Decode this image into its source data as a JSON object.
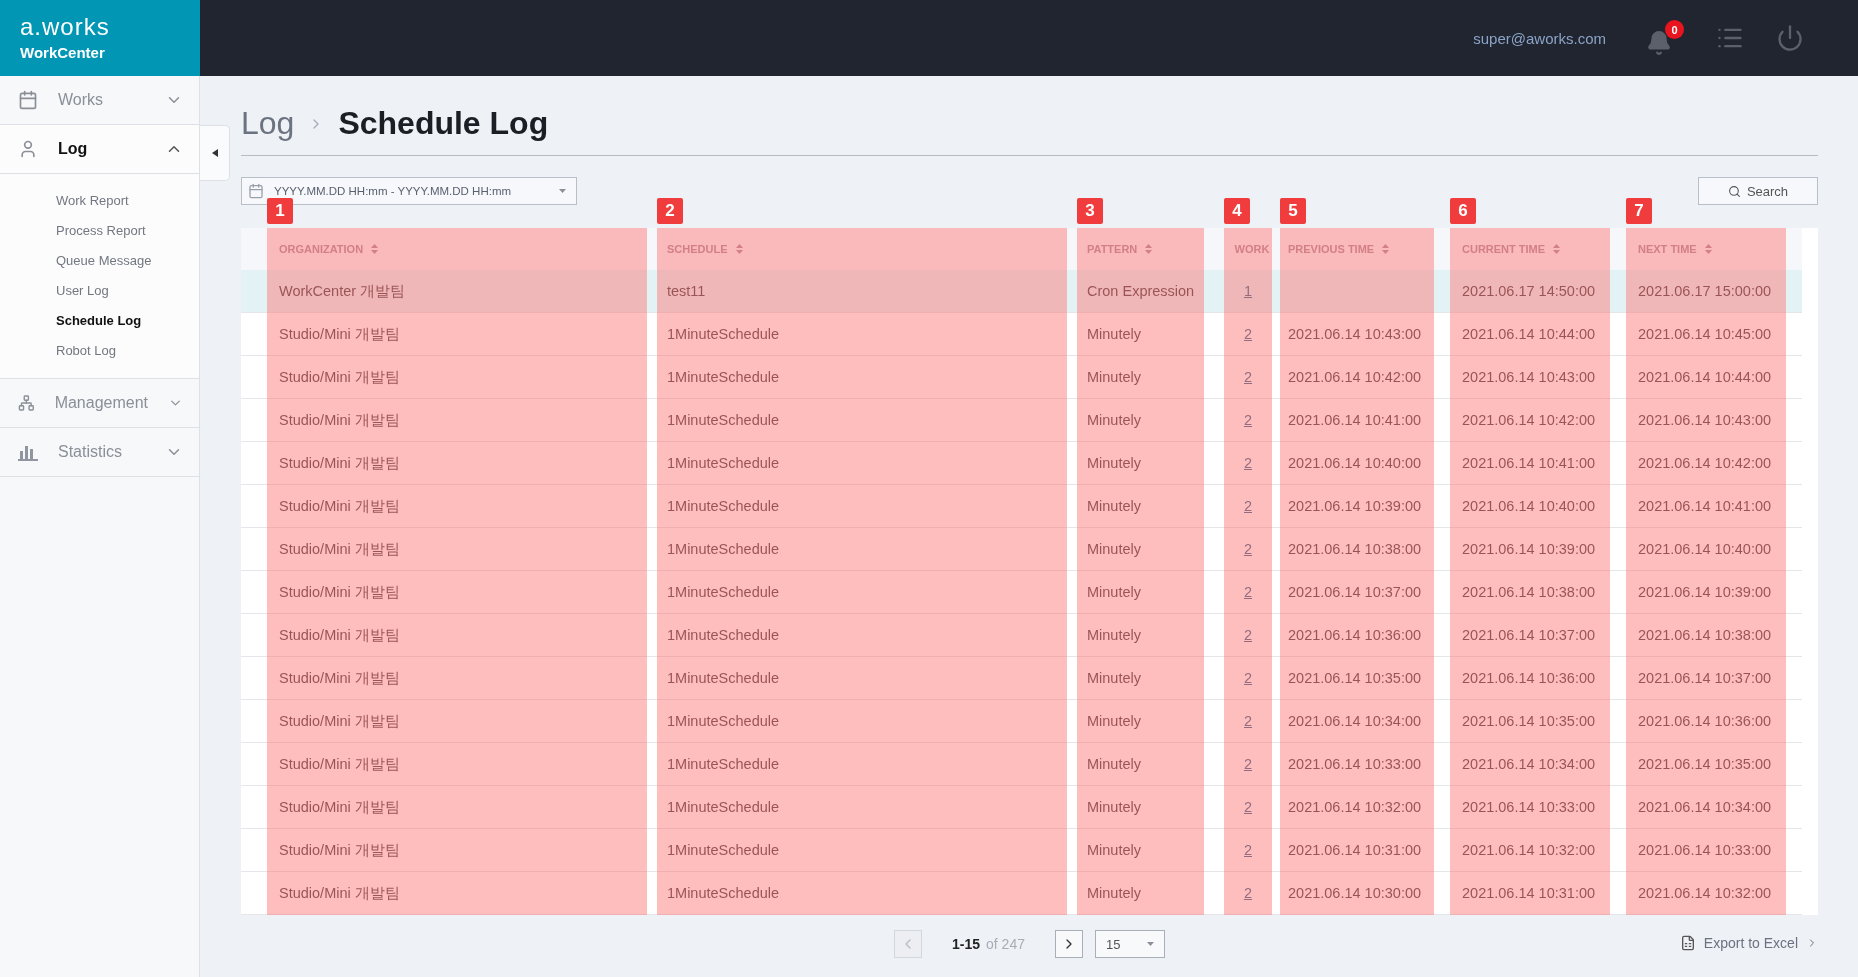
{
  "brand": {
    "logo": "a.works",
    "product": "WorkCenter"
  },
  "sidebar": {
    "items": [
      {
        "label": "Works",
        "expanded": false,
        "selected": false
      },
      {
        "label": "Log",
        "expanded": true,
        "selected": true,
        "children": [
          {
            "label": "Work Report",
            "selected": false
          },
          {
            "label": "Process Report",
            "selected": false
          },
          {
            "label": "Queue Message",
            "selected": false
          },
          {
            "label": "User Log",
            "selected": false
          },
          {
            "label": "Schedule Log",
            "selected": true
          },
          {
            "label": "Robot Log",
            "selected": false
          }
        ]
      },
      {
        "label": "Management",
        "expanded": false,
        "selected": false
      },
      {
        "label": "Statistics",
        "expanded": false,
        "selected": false
      }
    ]
  },
  "header": {
    "user": "super@aworks.com",
    "notifications": "0"
  },
  "breadcrumb": {
    "parent": "Log",
    "title": "Schedule Log"
  },
  "filter": {
    "placeholder": "YYYY.MM.DD HH:mm - YYYY.MM.DD HH:mm",
    "search_button": "Search"
  },
  "table": {
    "columns": [
      {
        "label": "ORGANIZATION",
        "sortable": true,
        "annotation": "1"
      },
      {
        "label": "SCHEDULE",
        "sortable": true,
        "annotation": "2"
      },
      {
        "label": "PATTERN",
        "sortable": true,
        "annotation": "3"
      },
      {
        "label": "WORK",
        "sortable": false,
        "annotation": "4"
      },
      {
        "label": "PREVIOUS TIME",
        "sortable": true,
        "annotation": "5"
      },
      {
        "label": "CURRENT TIME",
        "sortable": true,
        "annotation": "6"
      },
      {
        "label": "NEXT TIME",
        "sortable": true,
        "annotation": "7"
      }
    ],
    "rows": [
      {
        "selected": true,
        "cells": [
          "WorkCenter 개발팀",
          "test11",
          "Cron Expression",
          "1",
          null,
          "2021.06.17 14:50:00",
          "2021.06.17 15:00:00"
        ]
      },
      {
        "selected": false,
        "cells": [
          "Studio/Mini 개발팀",
          "1MinuteSchedule",
          "Minutely",
          "2",
          "2021.06.14 10:43:00",
          "2021.06.14 10:44:00",
          "2021.06.14 10:45:00"
        ]
      },
      {
        "selected": false,
        "cells": [
          "Studio/Mini 개발팀",
          "1MinuteSchedule",
          "Minutely",
          "2",
          "2021.06.14 10:42:00",
          "2021.06.14 10:43:00",
          "2021.06.14 10:44:00"
        ]
      },
      {
        "selected": false,
        "cells": [
          "Studio/Mini 개발팀",
          "1MinuteSchedule",
          "Minutely",
          "2",
          "2021.06.14 10:41:00",
          "2021.06.14 10:42:00",
          "2021.06.14 10:43:00"
        ]
      },
      {
        "selected": false,
        "cells": [
          "Studio/Mini 개발팀",
          "1MinuteSchedule",
          "Minutely",
          "2",
          "2021.06.14 10:40:00",
          "2021.06.14 10:41:00",
          "2021.06.14 10:42:00"
        ]
      },
      {
        "selected": false,
        "cells": [
          "Studio/Mini 개발팀",
          "1MinuteSchedule",
          "Minutely",
          "2",
          "2021.06.14 10:39:00",
          "2021.06.14 10:40:00",
          "2021.06.14 10:41:00"
        ]
      },
      {
        "selected": false,
        "cells": [
          "Studio/Mini 개발팀",
          "1MinuteSchedule",
          "Minutely",
          "2",
          "2021.06.14 10:38:00",
          "2021.06.14 10:39:00",
          "2021.06.14 10:40:00"
        ]
      },
      {
        "selected": false,
        "cells": [
          "Studio/Mini 개발팀",
          "1MinuteSchedule",
          "Minutely",
          "2",
          "2021.06.14 10:37:00",
          "2021.06.14 10:38:00",
          "2021.06.14 10:39:00"
        ]
      },
      {
        "selected": false,
        "cells": [
          "Studio/Mini 개발팀",
          "1MinuteSchedule",
          "Minutely",
          "2",
          "2021.06.14 10:36:00",
          "2021.06.14 10:37:00",
          "2021.06.14 10:38:00"
        ]
      },
      {
        "selected": false,
        "cells": [
          "Studio/Mini 개발팀",
          "1MinuteSchedule",
          "Minutely",
          "2",
          "2021.06.14 10:35:00",
          "2021.06.14 10:36:00",
          "2021.06.14 10:37:00"
        ]
      },
      {
        "selected": false,
        "cells": [
          "Studio/Mini 개발팀",
          "1MinuteSchedule",
          "Minutely",
          "2",
          "2021.06.14 10:34:00",
          "2021.06.14 10:35:00",
          "2021.06.14 10:36:00"
        ]
      },
      {
        "selected": false,
        "cells": [
          "Studio/Mini 개발팀",
          "1MinuteSchedule",
          "Minutely",
          "2",
          "2021.06.14 10:33:00",
          "2021.06.14 10:34:00",
          "2021.06.14 10:35:00"
        ]
      },
      {
        "selected": false,
        "cells": [
          "Studio/Mini 개발팀",
          "1MinuteSchedule",
          "Minutely",
          "2",
          "2021.06.14 10:32:00",
          "2021.06.14 10:33:00",
          "2021.06.14 10:34:00"
        ]
      },
      {
        "selected": false,
        "cells": [
          "Studio/Mini 개발팀",
          "1MinuteSchedule",
          "Minutely",
          "2",
          "2021.06.14 10:31:00",
          "2021.06.14 10:32:00",
          "2021.06.14 10:33:00"
        ]
      },
      {
        "selected": false,
        "cells": [
          "Studio/Mini 개발팀",
          "1MinuteSchedule",
          "Minutely",
          "2",
          "2021.06.14 10:30:00",
          "2021.06.14 10:31:00",
          "2021.06.14 10:32:00"
        ]
      }
    ]
  },
  "pagination": {
    "range": "1-15",
    "total": "of 247",
    "previous_disabled": true,
    "next_disabled": false,
    "page_size": "15"
  },
  "export": {
    "label": "Export to Excel"
  }
}
